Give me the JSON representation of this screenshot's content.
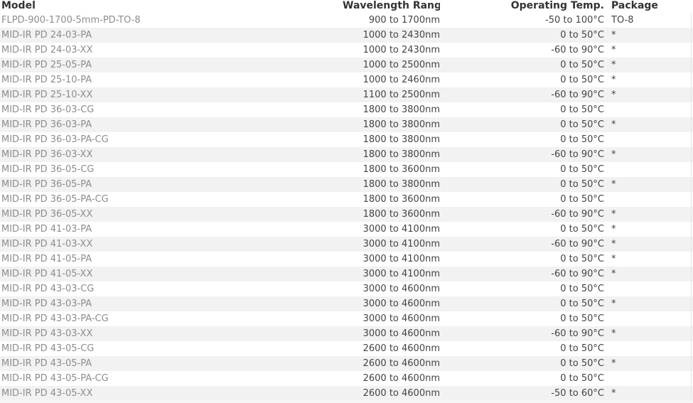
{
  "table": {
    "headers": {
      "model": "Model",
      "wavelength": "Wavelength Range",
      "temp": "Operating Temp.",
      "package": "Package"
    },
    "rows": [
      {
        "model": "FLPD-900-1700-5mm-PD-TO-8",
        "wavelength": "900 to 1700nm",
        "temp": "-50 to 100°C",
        "package": "TO-8"
      },
      {
        "model": "MID-IR PD 24-03-PA",
        "wavelength": "1000 to 2430nm",
        "temp": "0 to 50°C",
        "package": "*"
      },
      {
        "model": "MID-IR PD 24-03-XX",
        "wavelength": "1000 to 2430nm",
        "temp": "-60 to 90°C",
        "package": "*"
      },
      {
        "model": "MID-IR PD 25-05-PA",
        "wavelength": "1000 to 2500nm",
        "temp": "0 to 50°C",
        "package": "*"
      },
      {
        "model": "MID-IR PD 25-10-PA",
        "wavelength": "1000 to 2460nm",
        "temp": "0 to 50°C",
        "package": "*"
      },
      {
        "model": "MID-IR PD 25-10-XX",
        "wavelength": "1100 to 2500nm",
        "temp": "-60 to 90°C",
        "package": "*"
      },
      {
        "model": "MID-IR PD 36-03-CG",
        "wavelength": "1800 to 3800nm",
        "temp": "0 to 50°C",
        "package": ""
      },
      {
        "model": "MID-IR PD 36-03-PA",
        "wavelength": "1800 to 3800nm",
        "temp": "0 to 50°C",
        "package": "*"
      },
      {
        "model": "MID-IR PD 36-03-PA-CG",
        "wavelength": "1800 to 3800nm",
        "temp": "0 to 50°C",
        "package": ""
      },
      {
        "model": "MID-IR PD 36-03-XX",
        "wavelength": "1800 to 3800nm",
        "temp": "-60 to 90°C",
        "package": "*"
      },
      {
        "model": "MID-IR PD 36-05-CG",
        "wavelength": "1800 to 3600nm",
        "temp": "0 to 50°C",
        "package": ""
      },
      {
        "model": "MID-IR PD 36-05-PA",
        "wavelength": "1800 to 3800nm",
        "temp": "0 to 50°C",
        "package": "*"
      },
      {
        "model": "MID-IR PD 36-05-PA-CG",
        "wavelength": "1800 to 3600nm",
        "temp": "0 to 50°C",
        "package": ""
      },
      {
        "model": "MID-IR PD 36-05-XX",
        "wavelength": "1800 to 3600nm",
        "temp": "-60 to 90°C",
        "package": "*"
      },
      {
        "model": "MID-IR PD 41-03-PA",
        "wavelength": "3000 to 4100nm",
        "temp": "0 to 50°C",
        "package": "*"
      },
      {
        "model": "MID-IR PD 41-03-XX",
        "wavelength": "3000 to 4100nm",
        "temp": "-60 to 90°C",
        "package": "*"
      },
      {
        "model": "MID-IR PD 41-05-PA",
        "wavelength": "3000 to 4100nm",
        "temp": "0 to 50°C",
        "package": "*"
      },
      {
        "model": "MID-IR PD 41-05-XX",
        "wavelength": "3000 to 4100nm",
        "temp": "-60 to 90°C",
        "package": "*"
      },
      {
        "model": "MID-IR PD 43-03-CG",
        "wavelength": "3000 to 4600nm",
        "temp": "0 to 50°C",
        "package": ""
      },
      {
        "model": "MID-IR PD 43-03-PA",
        "wavelength": "3000 to 4600nm",
        "temp": "0 to 50°C",
        "package": "*"
      },
      {
        "model": "MID-IR PD 43-03-PA-CG",
        "wavelength": "3000 to 4600nm",
        "temp": "0 to 50°C",
        "package": ""
      },
      {
        "model": "MID-IR PD 43-03-XX",
        "wavelength": "3000 to 4600nm",
        "temp": "-60 to 90°C",
        "package": "*"
      },
      {
        "model": "MID-IR PD 43-05-CG",
        "wavelength": "2600 to 4600nm",
        "temp": "0 to 50°C",
        "package": ""
      },
      {
        "model": "MID-IR PD 43-05-PA",
        "wavelength": "2600 to 4600nm",
        "temp": "0 to 50°C",
        "package": "*"
      },
      {
        "model": "MID-IR PD 43-05-PA-CG",
        "wavelength": "2600 to 4600nm",
        "temp": "0 to 50°C",
        "package": ""
      },
      {
        "model": "MID-IR PD 43-05-XX",
        "wavelength": "2600 to 4600nm",
        "temp": "-50 to 60°C",
        "package": "*"
      }
    ]
  },
  "colors": {
    "header_text": "#333333",
    "model_link": "#8a8f8a",
    "cell_text": "#444444",
    "stripe": "#f2f2f2"
  }
}
